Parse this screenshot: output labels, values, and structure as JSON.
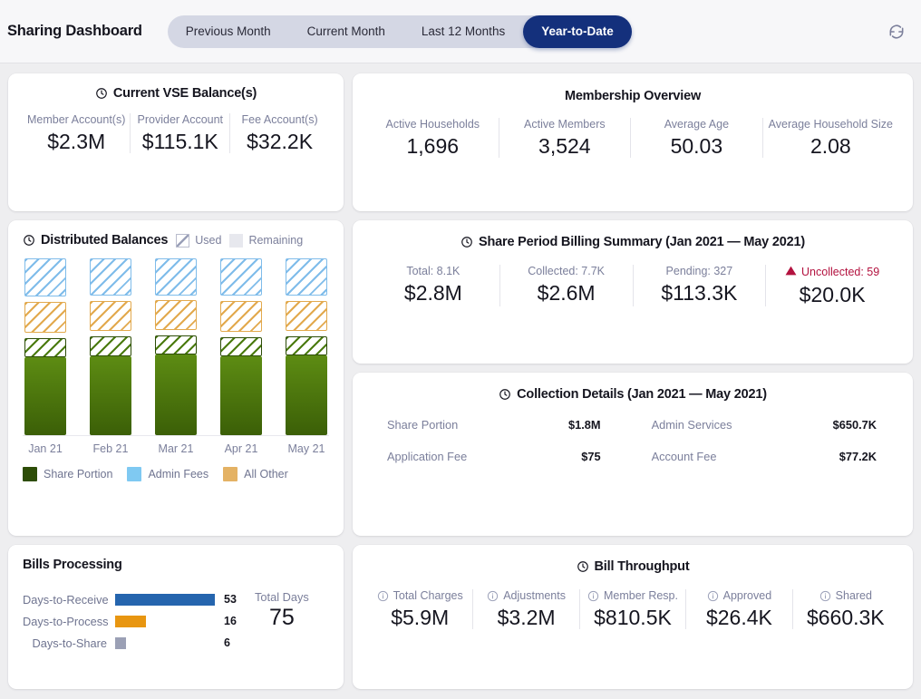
{
  "header": {
    "title": "Sharing Dashboard",
    "tabs": [
      {
        "label": "Previous Month",
        "active": false
      },
      {
        "label": "Current Month",
        "active": false
      },
      {
        "label": "Last 12 Months",
        "active": false
      },
      {
        "label": "Year-to-Date",
        "active": true
      }
    ],
    "refresh_icon": "refresh-icon",
    "active_tab_color": "#14307c",
    "tab_group_bg": "#d4d7e4"
  },
  "vse_balances": {
    "title": "Current VSE Balance(s)",
    "icon": "clock-icon",
    "items": [
      {
        "label": "Member Account(s)",
        "value": "$2.3M"
      },
      {
        "label": "Provider Account",
        "value": "$115.1K"
      },
      {
        "label": "Fee Account(s)",
        "value": "$32.2K"
      }
    ]
  },
  "membership_overview": {
    "title": "Membership Overview",
    "items": [
      {
        "label": "Active Households",
        "value": "1,696"
      },
      {
        "label": "Active Members",
        "value": "3,524"
      },
      {
        "label": "Average Age",
        "value": "50.03"
      },
      {
        "label": "Average Household Size",
        "value": "2.08"
      }
    ]
  },
  "distributed_balances": {
    "title": "Distributed Balances",
    "icon": "clock-icon",
    "fill_legend": [
      {
        "label": "Used",
        "style": "hatched"
      },
      {
        "label": "Remaining",
        "style": "plain"
      }
    ],
    "series_legend": [
      {
        "label": "Share Portion",
        "color": "#2d4d07"
      },
      {
        "label": "Admin Fees",
        "color": "#7fc9f2"
      },
      {
        "label": "All Other",
        "color": "#e4b264"
      }
    ]
  },
  "chart_data": {
    "type": "bar",
    "title": "Distributed Balances",
    "categories": [
      "Jan 21",
      "Feb 21",
      "Mar 21",
      "Apr 21",
      "May 21"
    ],
    "xlabel": "",
    "ylabel": "",
    "grid": false,
    "legend": "bottom",
    "stacked": true,
    "series": [
      {
        "name": "Share Portion",
        "fill": "used",
        "color": "#4a7612",
        "values": [
          112,
          115,
          118,
          114,
          116
        ]
      },
      {
        "name": "Share Portion",
        "fill": "remaining",
        "color": "#2d4d07",
        "values": [
          22,
          22,
          22,
          22,
          22
        ]
      },
      {
        "name": "All Other",
        "fill": "remaining",
        "color": "#e2a94d",
        "values": [
          34,
          34,
          34,
          34,
          34
        ]
      },
      {
        "name": "Admin Fees",
        "fill": "remaining",
        "color": "#7fbcea",
        "values": [
          42,
          42,
          42,
          42,
          42
        ]
      }
    ]
  },
  "billing_summary": {
    "title": "Share Period Billing Summary (Jan 2021 — May 2021)",
    "icon": "clock-icon",
    "items": [
      {
        "label": "Total: 8.1K",
        "value": "$2.8M",
        "alert": false
      },
      {
        "label": "Collected: 7.7K",
        "value": "$2.6M",
        "alert": false
      },
      {
        "label": "Pending: 327",
        "value": "$113.3K",
        "alert": false
      },
      {
        "label": "Uncollected: 59",
        "value": "$20.0K",
        "alert": true,
        "alert_icon": "warning-triangle-icon",
        "alert_color": "#b3123f"
      }
    ]
  },
  "collection_details": {
    "title": "Collection Details (Jan 2021 — May 2021)",
    "icon": "clock-icon",
    "rows": [
      {
        "label_a": "Share Portion",
        "value_a": "$1.8M",
        "label_b": "Admin Services",
        "value_b": "$650.7K"
      },
      {
        "label_a": "Application Fee",
        "value_a": "$75",
        "label_b": "Account Fee",
        "value_b": "$77.2K"
      }
    ]
  },
  "bills_processing": {
    "title": "Bills Processing",
    "bars": [
      {
        "label": "Days-to-Receive",
        "value": "53",
        "width_pct": 100,
        "color": "#2565ae"
      },
      {
        "label": "Days-to-Process",
        "value": "16",
        "width_pct": 31,
        "color": "#e89611"
      },
      {
        "label": "Days-to-Share",
        "value": "6",
        "width_pct": 11,
        "color": "#9ba0b5"
      }
    ],
    "total_label": "Total Days",
    "total_value": "75"
  },
  "bill_throughput": {
    "title": "Bill Throughput",
    "icon": "clock-icon",
    "items": [
      {
        "label": "Total Charges",
        "value": "$5.9M",
        "icon": "info-icon"
      },
      {
        "label": "Adjustments",
        "value": "$3.2M",
        "icon": "info-icon"
      },
      {
        "label": "Member Resp.",
        "value": "$810.5K",
        "icon": "info-icon"
      },
      {
        "label": "Approved",
        "value": "$26.4K",
        "icon": "info-icon"
      },
      {
        "label": "Shared",
        "value": "$660.3K",
        "icon": "info-icon"
      }
    ]
  }
}
